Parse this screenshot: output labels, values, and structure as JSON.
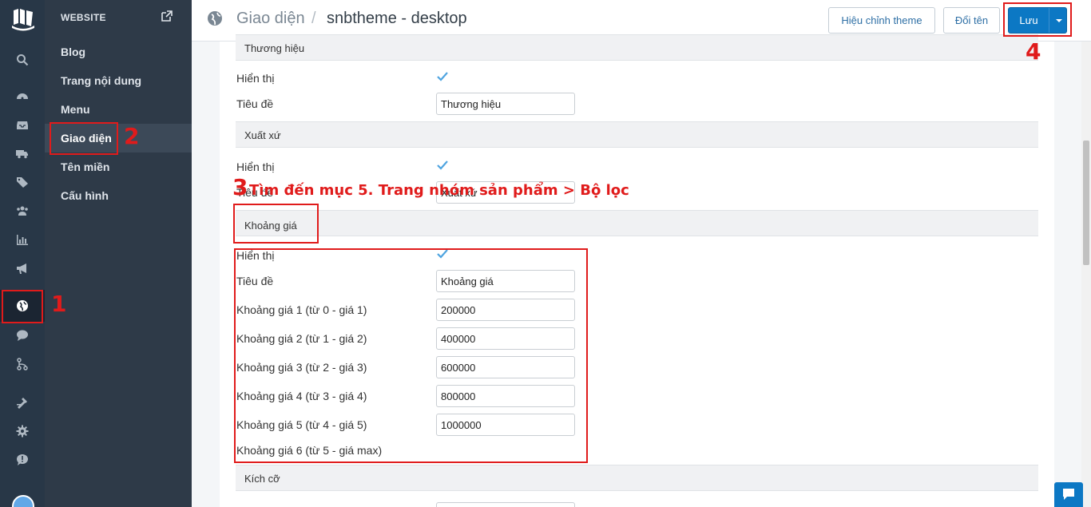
{
  "rail": {
    "icons": [
      "search-icon",
      "dashboard-icon",
      "inbox-icon",
      "truck-icon",
      "tag-icon",
      "users-icon",
      "bar-chart-icon",
      "megaphone-icon",
      "globe-icon",
      "chat-bubble-icon",
      "branch-icon",
      "tools-icon",
      "gear-icon",
      "alert-bubble-icon"
    ],
    "active": "globe-icon"
  },
  "sidebar": {
    "header": "WEBSITE",
    "items": [
      {
        "label": "Blog"
      },
      {
        "label": "Trang nội dung"
      },
      {
        "label": "Menu"
      },
      {
        "label": "Giao diện"
      },
      {
        "label": "Tên miền"
      },
      {
        "label": "Cấu hình"
      }
    ],
    "active_index": 3
  },
  "header": {
    "breadcrumb": "Giao diện",
    "separator": "/",
    "title": "snbtheme - desktop",
    "edit_theme_label": "Hiệu chỉnh theme",
    "rename_label": "Đổi tên",
    "save_label": "Lưu"
  },
  "sections": {
    "brand": {
      "title": "Thương hiệu",
      "show_label": "Hiển thị",
      "show_checked": true,
      "title_label": "Tiêu đề",
      "title_value": "Thương hiệu"
    },
    "origin": {
      "title": "Xuất xứ",
      "show_label": "Hiển thị",
      "show_checked": true,
      "title_label": "Tiêu đề",
      "title_value": "Xuất xứ"
    },
    "price_range": {
      "title": "Khoảng giá",
      "show_label": "Hiển thị",
      "show_checked": true,
      "title_label": "Tiêu đề",
      "title_value": "Khoảng giá",
      "ranges": [
        {
          "label": "Khoảng giá 1 (từ 0 - giá 1)",
          "value": "200000"
        },
        {
          "label": "Khoảng giá 2 (từ 1 - giá 2)",
          "value": "400000"
        },
        {
          "label": "Khoảng giá 3 (từ 2 - giá 3)",
          "value": "600000"
        },
        {
          "label": "Khoảng giá 4 (từ 3 - giá 4)",
          "value": "800000"
        },
        {
          "label": "Khoảng giá 5 (từ 4 - giá 5)",
          "value": "1000000"
        },
        {
          "label": "Khoảng giá 6 (từ 5 - giá max)",
          "value": ""
        }
      ]
    },
    "size": {
      "title": "Kích cỡ"
    }
  },
  "annotations": {
    "n1": "1",
    "n2": "2",
    "n3": "3",
    "n4": "4",
    "instruction": "Tìm đến mục 5. Trang nhóm sản phẩm > Bộ lọc",
    "color": "#e01b1b"
  },
  "colors": {
    "rail_bg": "#283747",
    "sidebar_bg": "#2e3a48",
    "primary": "#0c78c4"
  }
}
